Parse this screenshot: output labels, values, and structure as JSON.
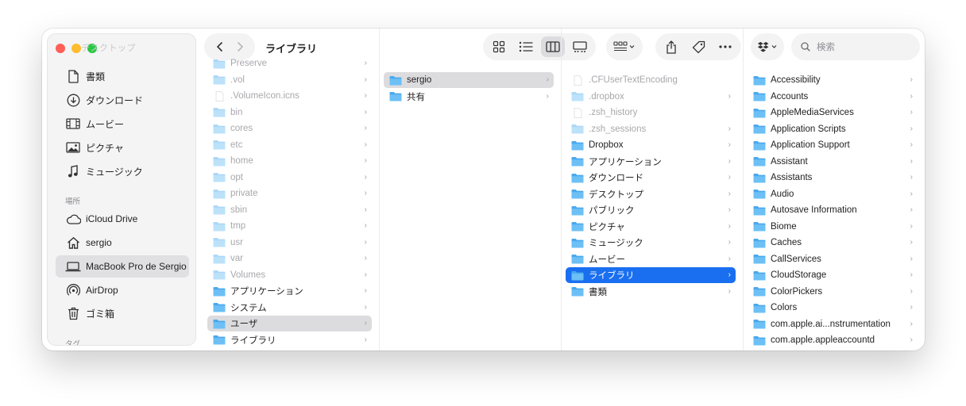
{
  "window": {
    "title": "ライブラリ"
  },
  "colors": {
    "accent": "#1a6ff0",
    "folder": "#4aa9ee",
    "close": "#ff5f57",
    "minimize": "#febc2e",
    "zoom": "#28c840"
  },
  "sidebar": {
    "ghost_text": "デスクトップ",
    "favorites": [
      {
        "label": "書類",
        "icon": "document-icon"
      },
      {
        "label": "ダウンロード",
        "icon": "download-icon"
      },
      {
        "label": "ムービー",
        "icon": "film-icon"
      },
      {
        "label": "ピクチャ",
        "icon": "photo-icon"
      },
      {
        "label": "ミュージック",
        "icon": "music-icon"
      }
    ],
    "locations_header": "場所",
    "locations": [
      {
        "label": "iCloud Drive",
        "icon": "cloud-icon"
      },
      {
        "label": "sergio",
        "icon": "home-icon"
      },
      {
        "label": "MacBook Pro de Sergio",
        "icon": "laptop-icon",
        "selected": true
      },
      {
        "label": "AirDrop",
        "icon": "airdrop-icon"
      },
      {
        "label": "ゴミ箱",
        "icon": "trash-icon"
      }
    ],
    "tags_header": "タグ"
  },
  "toolbar": {
    "back_icon": "chevron-left-icon",
    "forward_icon": "chevron-right-icon",
    "view_modes": [
      "icon-view-icon",
      "list-view-icon",
      "column-view-icon",
      "gallery-view-icon"
    ],
    "active_view": "column-view-icon",
    "search_placeholder": "検索"
  },
  "columns": [
    [
      {
        "name": "Preserve",
        "dim": true
      },
      {
        "name": ".vol",
        "dim": true
      },
      {
        "name": ".VolumeIcon.icns",
        "dim": true,
        "file": true
      },
      {
        "name": "bin",
        "dim": true
      },
      {
        "name": "cores",
        "dim": true
      },
      {
        "name": "etc",
        "dim": true
      },
      {
        "name": "home",
        "dim": true
      },
      {
        "name": "opt",
        "dim": true
      },
      {
        "name": "private",
        "dim": true
      },
      {
        "name": "sbin",
        "dim": true
      },
      {
        "name": "tmp",
        "dim": true
      },
      {
        "name": "usr",
        "dim": true
      },
      {
        "name": "var",
        "dim": true
      },
      {
        "name": "Volumes",
        "dim": true
      },
      {
        "name": "アプリケーション"
      },
      {
        "name": "システム"
      },
      {
        "name": "ユーザ",
        "selected": "gray"
      },
      {
        "name": "ライブラリ"
      }
    ],
    [
      {
        "name": "sergio",
        "selected": "gray"
      },
      {
        "name": "共有"
      }
    ],
    [
      {
        "name": ".CFUserTextEncoding",
        "dim": true,
        "file": true,
        "nochev": true
      },
      {
        "name": ".dropbox",
        "dim": true
      },
      {
        "name": ".zsh_history",
        "dim": true,
        "file": true,
        "nochev": true
      },
      {
        "name": ".zsh_sessions",
        "dim": true
      },
      {
        "name": "Dropbox"
      },
      {
        "name": "アプリケーション"
      },
      {
        "name": "ダウンロード"
      },
      {
        "name": "デスクトップ"
      },
      {
        "name": "パブリック"
      },
      {
        "name": "ピクチャ"
      },
      {
        "name": "ミュージック"
      },
      {
        "name": "ムービー"
      },
      {
        "name": "ライブラリ",
        "selected": "blue"
      },
      {
        "name": "書類"
      }
    ],
    [
      {
        "name": "Accessibility"
      },
      {
        "name": "Accounts"
      },
      {
        "name": "AppleMediaServices"
      },
      {
        "name": "Application Scripts"
      },
      {
        "name": "Application Support"
      },
      {
        "name": "Assistant"
      },
      {
        "name": "Assistants"
      },
      {
        "name": "Audio"
      },
      {
        "name": "Autosave Information"
      },
      {
        "name": "Biome"
      },
      {
        "name": "Caches"
      },
      {
        "name": "CallServices"
      },
      {
        "name": "CloudStorage"
      },
      {
        "name": "ColorPickers"
      },
      {
        "name": "Colors"
      },
      {
        "name": "com.apple.ai...nstrumentation"
      },
      {
        "name": "com.apple.appleaccountd"
      }
    ]
  ]
}
